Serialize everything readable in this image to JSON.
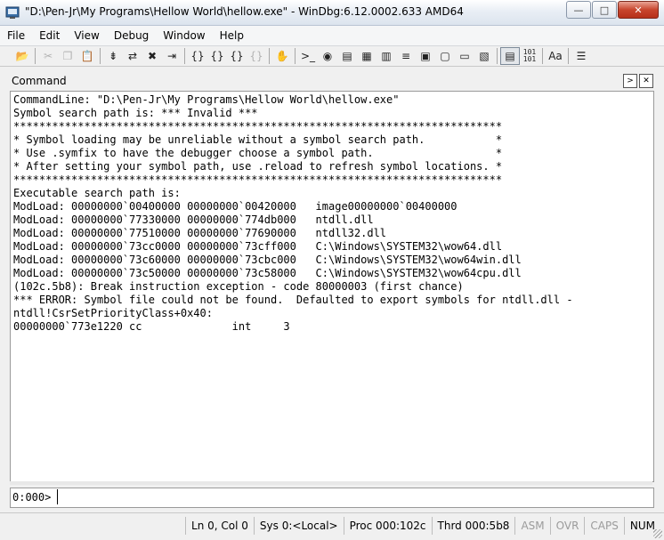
{
  "window": {
    "title": "\"D:\\Pen-Jr\\My Programs\\Hellow World\\hellow.exe\" - WinDbg:6.12.0002.633 AMD64",
    "minimize_glyph": "—",
    "maximize_glyph": "□",
    "close_glyph": "✕"
  },
  "menu": [
    "File",
    "Edit",
    "View",
    "Debug",
    "Window",
    "Help"
  ],
  "toolbar": {
    "open_glyph": "📂",
    "cut_glyph": "✂",
    "copy_glyph": "❐",
    "paste_glyph": "📋",
    "go_glyph": "⇟",
    "restart_glyph": "⇄",
    "stop_glyph": "✖",
    "break_glyph": "⇥",
    "step_into_glyph": "{}",
    "step_over_glyph": "{}",
    "step_out_glyph": "{}",
    "run_cursor_glyph": "{}",
    "hand_glyph": "✋",
    "cmd_glyph": ">_",
    "watch_glyph": "◉",
    "locals_glyph": "▤",
    "registers_glyph": "▦",
    "memory_glyph": "▥",
    "callstack_glyph": "≡",
    "disasm_glyph": "▣",
    "scratch_glyph": "▢",
    "source_glyph": "▭",
    "processes_glyph": "▧",
    "source_mode_glyph": "▤",
    "hex_top": "101",
    "hex_bottom": "101",
    "font_glyph": "Aa",
    "options_glyph": "☰"
  },
  "command_window": {
    "title": "Command",
    "output_lines": [
      "CommandLine: \"D:\\Pen-Jr\\My Programs\\Hellow World\\hellow.exe\"",
      "Symbol search path is: *** Invalid ***",
      "****************************************************************************",
      "* Symbol loading may be unreliable without a symbol search path.           *",
      "* Use .symfix to have the debugger choose a symbol path.                   *",
      "* After setting your symbol path, use .reload to refresh symbol locations. *",
      "****************************************************************************",
      "Executable search path is:",
      "ModLoad: 00000000`00400000 00000000`00420000   image00000000`00400000",
      "ModLoad: 00000000`77330000 00000000`774db000   ntdll.dll",
      "ModLoad: 00000000`77510000 00000000`77690000   ntdll32.dll",
      "ModLoad: 00000000`73cc0000 00000000`73cff000   C:\\Windows\\SYSTEM32\\wow64.dll",
      "ModLoad: 00000000`73c60000 00000000`73cbc000   C:\\Windows\\SYSTEM32\\wow64win.dll",
      "ModLoad: 00000000`73c50000 00000000`73c58000   C:\\Windows\\SYSTEM32\\wow64cpu.dll",
      "(102c.5b8): Break instruction exception - code 80000003 (first chance)",
      "*** ERROR: Symbol file could not be found.  Defaulted to export symbols for ntdll.dll -",
      "ntdll!CsrSetPriorityClass+0x40:",
      "00000000`773e1220 cc              int     3"
    ],
    "prompt": "0:000>",
    "input_value": ""
  },
  "statusbar": {
    "position": "Ln 0, Col 0",
    "sys": "Sys 0:<Local>",
    "proc": "Proc 000:102c",
    "thrd": "Thrd 000:5b8",
    "asm": "ASM",
    "ovr": "OVR",
    "caps": "CAPS",
    "num": "NUM"
  },
  "colors": {
    "close_button": "#c8452d",
    "output_background": "#ffffff",
    "disabled_text": "#9b9b9b"
  }
}
